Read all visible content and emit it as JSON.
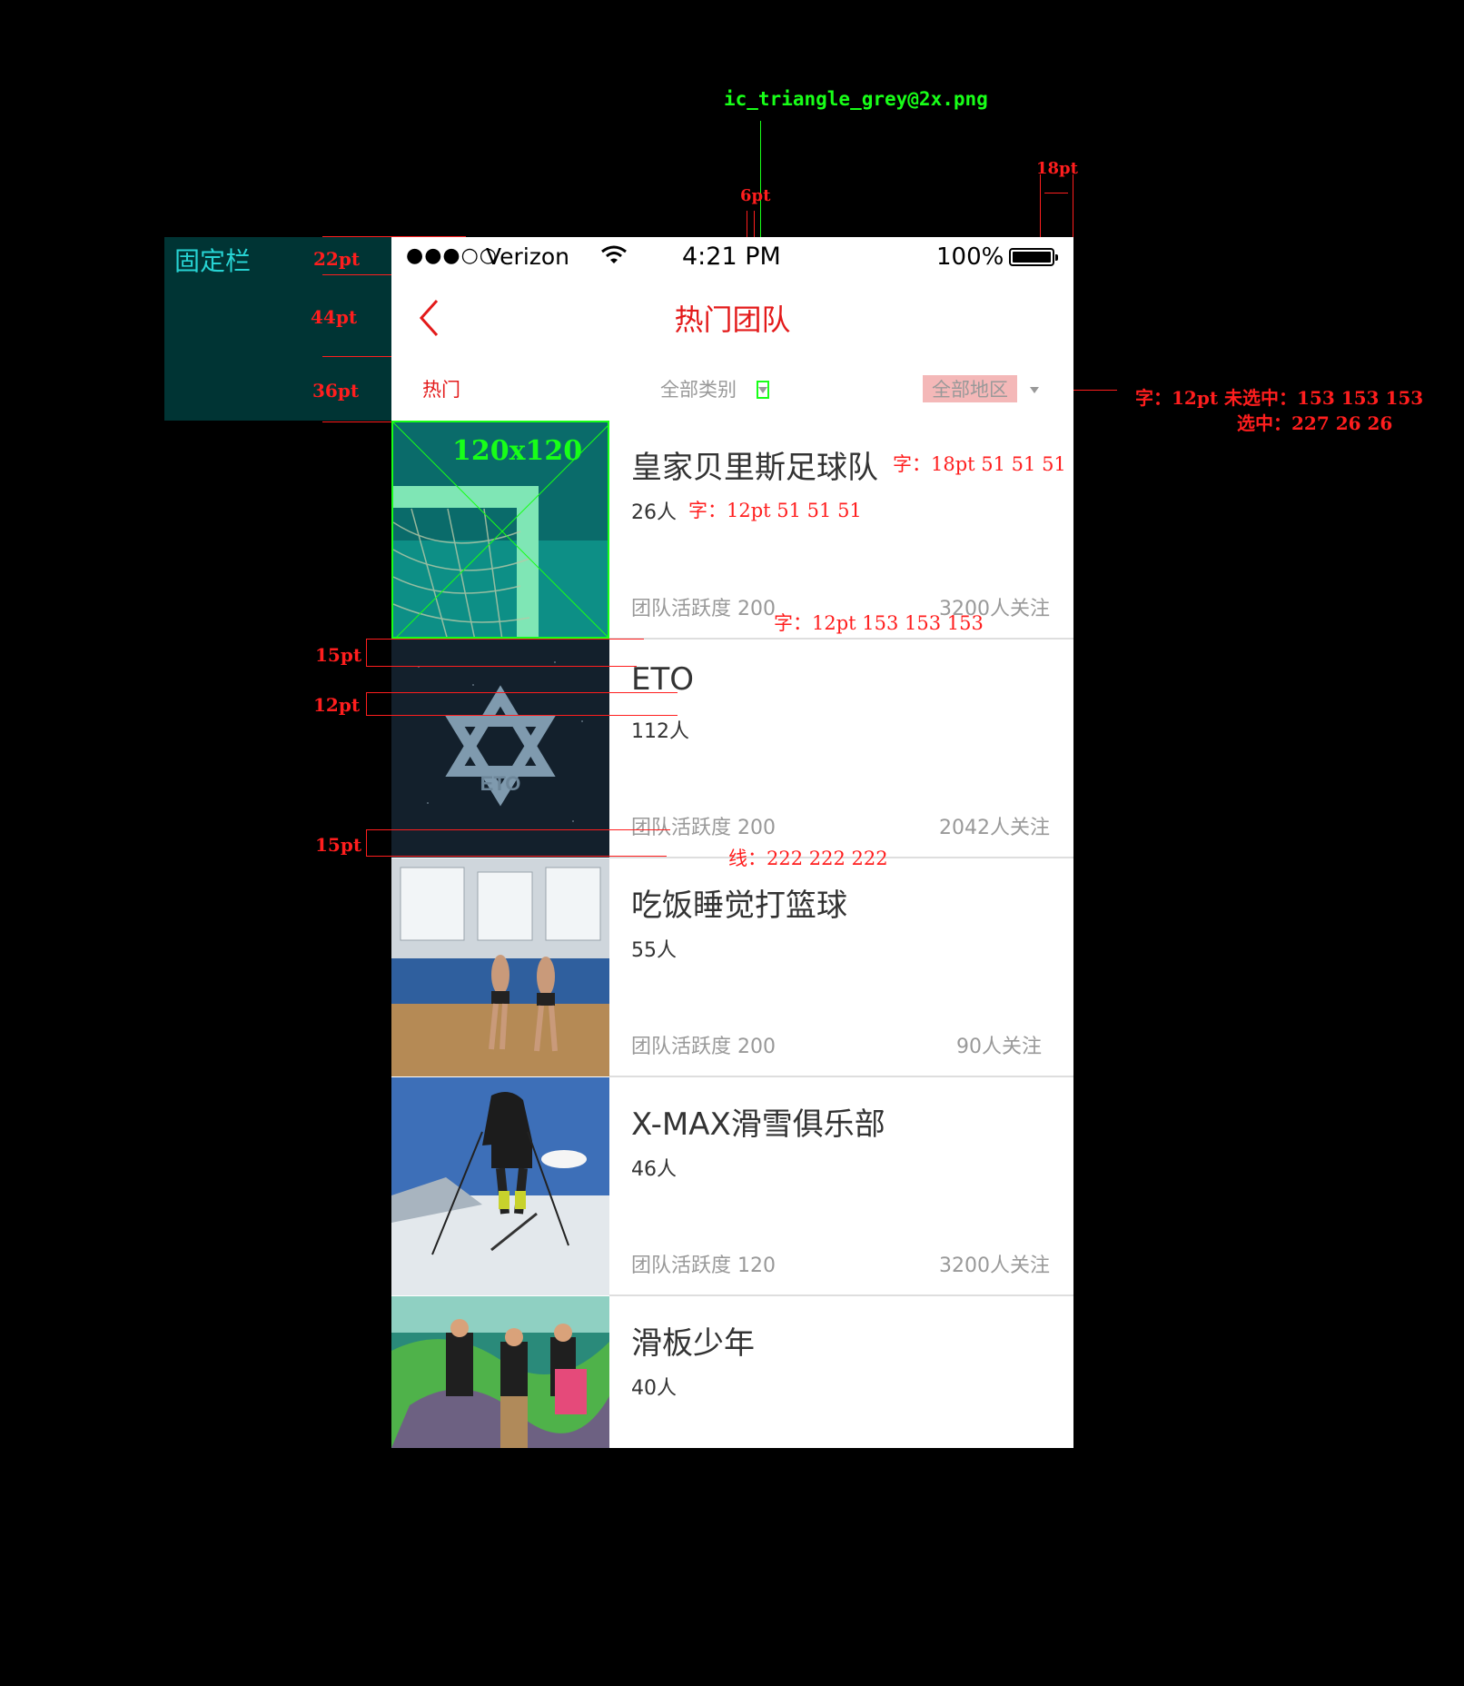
{
  "annotations": {
    "fixed_bar": "固定栏",
    "status_height": "22pt",
    "nav_height": "44pt",
    "filter_height": "36pt",
    "triangle_asset": "ic_triangle_grey@2x.png",
    "triangle_gap": "6pt",
    "right_margin": "18pt",
    "filter_font": "字：12pt 未选中：153 153 153",
    "filter_selected": "选中：227 26 26",
    "name_font": "字：18pt 51 51 51",
    "members_font": "字：12pt 51 51 51",
    "meta_font": "字：12pt 153 153 153",
    "thumb_size": "120x120",
    "top_padding": "15pt",
    "line_gap": "12pt",
    "bottom_padding": "15pt",
    "divider": "线：222 222 222"
  },
  "status_bar": {
    "signal": "●●●○○",
    "carrier": "Verizon",
    "time": "4:21 PM",
    "battery": "100%"
  },
  "nav": {
    "title": "热门团队"
  },
  "filters": {
    "hot": "热门",
    "category": "全部类别",
    "region": "全部地区"
  },
  "teams": [
    {
      "name": "皇家贝里斯足球队",
      "members": "26人",
      "activity": "团队活跃度 200",
      "follows": "3200人关注"
    },
    {
      "name": "ETO",
      "members": "112人",
      "activity": "团队活跃度 200",
      "follows": "2042人关注"
    },
    {
      "name": "吃饭睡觉打篮球",
      "members": "55人",
      "activity": "团队活跃度 200",
      "follows": "90人关注"
    },
    {
      "name": "X-MAX滑雪俱乐部",
      "members": "46人",
      "activity": "团队活跃度 120",
      "follows": "3200人关注"
    },
    {
      "name": "滑板少年",
      "members": "40人",
      "activity": "",
      "follows": ""
    }
  ],
  "colors": {
    "accent": "#e31a1a",
    "text_primary": "#333333",
    "text_secondary": "#999999",
    "divider": "#dedede",
    "annotation_red": "#ff1e1e",
    "annotation_green": "#18ff18",
    "fixed_panel": "#003434"
  }
}
